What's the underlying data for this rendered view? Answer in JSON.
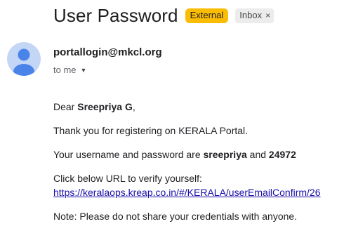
{
  "email": {
    "subject": "User Password",
    "labels": {
      "external": "External",
      "inbox": "Inbox",
      "inbox_close": "×"
    },
    "sender": "portallogin@mkcl.org",
    "recipient": "to me",
    "body": {
      "greeting_prefix": "Dear ",
      "greeting_name": "Sreepriya G",
      "greeting_suffix": ",",
      "thanks": "Thank you for registering on KERALA Portal.",
      "creds_prefix": "Your username and password are ",
      "username": "sreepriya",
      "creds_and": " and ",
      "password": "24972",
      "verify_text": "Click below URL to verify yourself:",
      "verify_link": "https://keralaops.kreap.co.in/#/KERALA/userEmailConfirm/26",
      "note": "Note: Please do not share your credentials with anyone."
    }
  },
  "colors": {
    "external_badge": "#fbbc04",
    "inbox_badge": "#ececec",
    "avatar_bg": "#c4d6f5",
    "avatar_fg": "#4a84e8",
    "link": "#1a0dab"
  },
  "icons": {
    "avatar": "person-icon",
    "recipient_caret": "caret-down-icon",
    "inbox_close": "close-icon"
  }
}
